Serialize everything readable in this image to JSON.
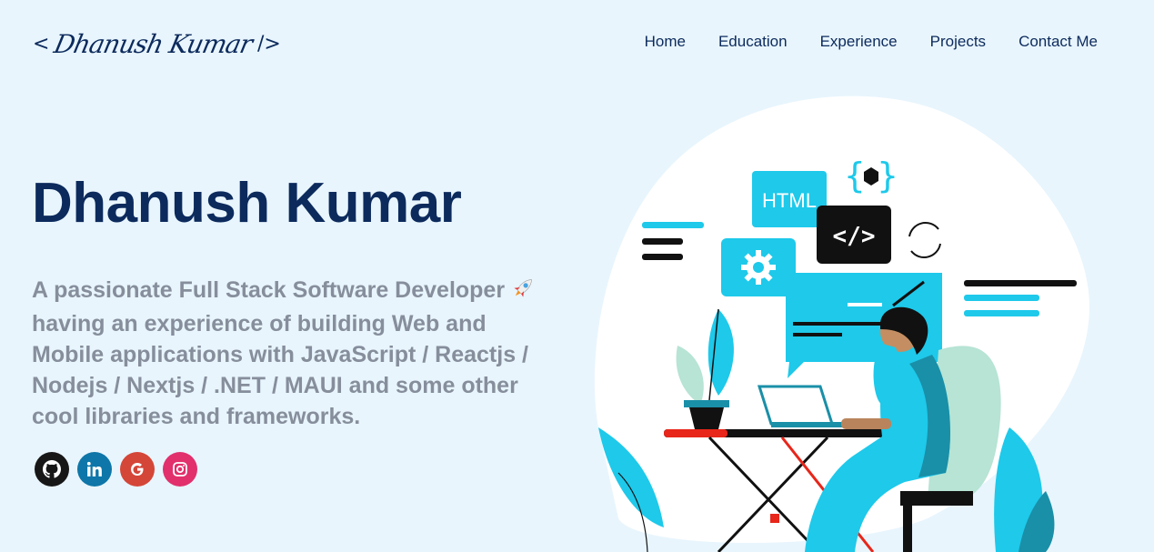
{
  "header": {
    "logo_open": "<",
    "logo_name": "Dhanush Kumar",
    "logo_close": "/>",
    "nav": [
      "Home",
      "Education",
      "Experience",
      "Projects",
      "Contact Me"
    ]
  },
  "hero": {
    "title": "Dhanush Kumar",
    "subtitle": "A passionate Full Stack Software Developer",
    "subtitle_rest": "having an experience of building Web and Mobile applications with JavaScript / Reactjs / Nodejs / Nextjs / .NET / MAUI and some other cool libraries and frameworks."
  },
  "socials": [
    {
      "icon": "github-icon",
      "color": "#181717"
    },
    {
      "icon": "linkedin-icon",
      "color": "#0e76a8"
    },
    {
      "icon": "google-icon",
      "color": "#d44638"
    },
    {
      "icon": "instagram-icon",
      "color": "#e1306c"
    }
  ],
  "illustration": {
    "html_label": "HTML",
    "code_label": "</>",
    "brace_label": "{ }"
  },
  "colors": {
    "background": "#e8f5fd",
    "primary": "#0c2a5c",
    "subtitle": "#868e9c",
    "accent": "#1ec9ea"
  }
}
